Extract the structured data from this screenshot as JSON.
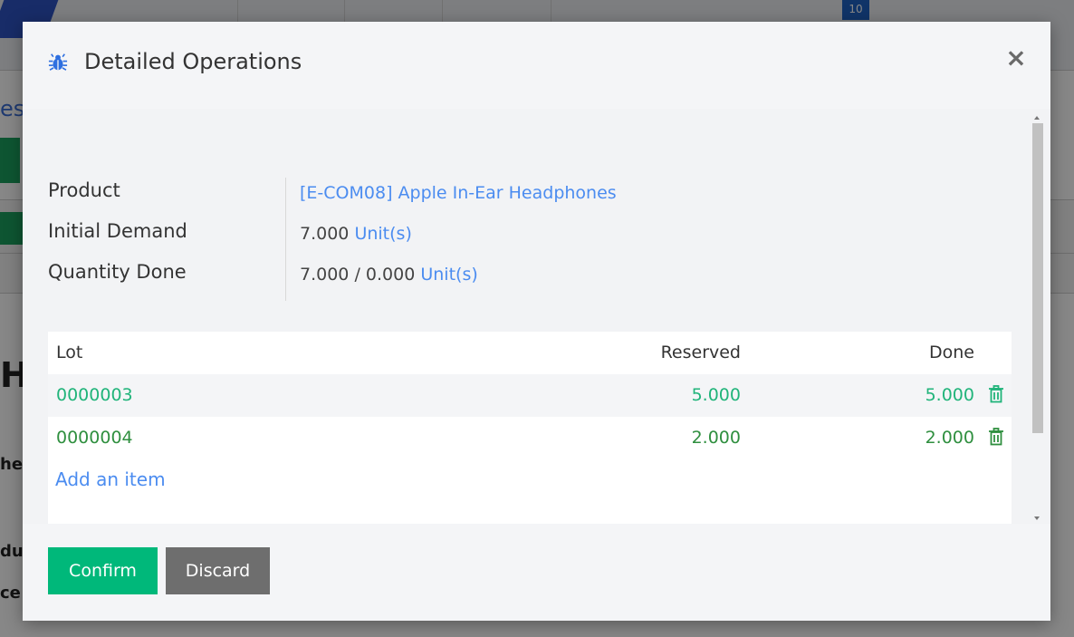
{
  "background": {
    "badge_count": "10",
    "left_fragments": [
      "es",
      "H/",
      "her",
      "du",
      "ce"
    ]
  },
  "modal": {
    "title": "Detailed Operations",
    "close_label": "×",
    "fields": [
      {
        "label": "Product",
        "value": "[E-COM08] Apple In-Ear Headphones"
      },
      {
        "label": "Initial Demand",
        "qty": "7.000",
        "unit": "Unit(s)"
      },
      {
        "label": "Quantity Done",
        "done": "7.000",
        "sep": "/",
        "total": "0.000",
        "unit": "Unit(s)"
      }
    ],
    "table": {
      "headers": {
        "lot": "Lot",
        "reserved": "Reserved",
        "done": "Done"
      },
      "rows": [
        {
          "lot": "0000003",
          "reserved": "5.000",
          "done": "5.000"
        },
        {
          "lot": "0000004",
          "reserved": "2.000",
          "done": "2.000"
        }
      ],
      "add_item": "Add an item"
    },
    "buttons": {
      "confirm": "Confirm",
      "discard": "Discard"
    }
  },
  "colors": {
    "accent_green": "#00b87a",
    "link_blue": "#4b8cf0",
    "discard_gray": "#6e6e6e",
    "bug_icon": "#2e6fe0"
  },
  "icons": [
    "bug-icon",
    "close-icon",
    "trash-icon"
  ]
}
